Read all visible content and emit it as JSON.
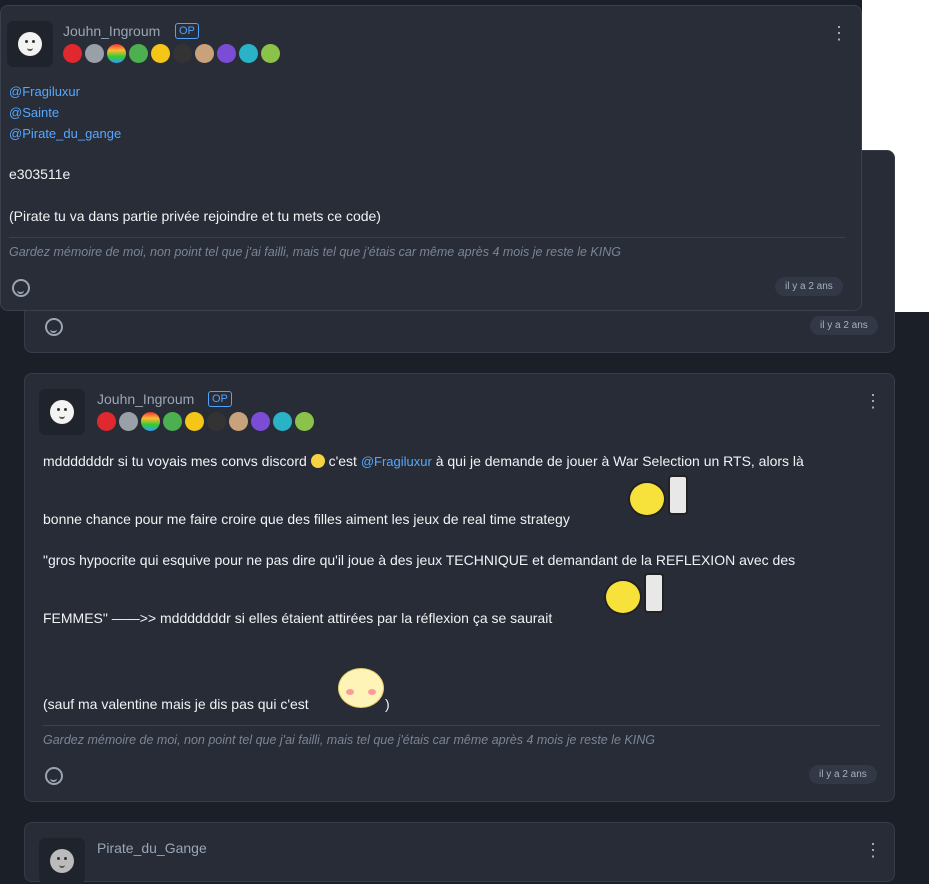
{
  "post1": {
    "username": "Jouhn_Ingroum",
    "op": "OP",
    "mentions": [
      "@Fragiluxur",
      "@Sainte",
      "@Pirate_du_gange"
    ],
    "code": "e303511e",
    "instruction": "(Pirate tu va dans partie privée rejoindre et tu mets ce code)",
    "signature": "Gardez mémoire de moi, non point tel que j'ai failli, mais tel que j'étais car même après 4 mois je reste le KING",
    "time": "il y a 2 ans"
  },
  "post0": {
    "time": "il y a 2 ans"
  },
  "post2": {
    "username": "Jouhn_Ingroum",
    "op": "OP",
    "line1_a": "mdddddddr si tu voyais mes convs discord",
    "line1_b": "c'est",
    "line1_mention": "@Fragiluxur",
    "line1_c": "à qui je demande de jouer à War Selection un RTS, alors là",
    "line2": "bonne chance pour me faire croire que des filles aiment les jeux de real time strategy",
    "line3": "\"gros hypocrite qui esquive pour ne pas dire qu'il joue à des jeux TECHNIQUE et demandant de la REFLEXION avec des",
    "line4": "FEMMES\" ——>> mdddddddr si elles étaient attirées par la réflexion ça se saurait",
    "line5_a": "(sauf ma valentine mais je dis pas qui c'est",
    "line5_b": ")",
    "signature": "Gardez mémoire de moi, non point tel que j'ai failli, mais tel que j'étais car même après 4 mois je reste le KING",
    "time": "il y a 2 ans"
  },
  "post3": {
    "username": "Pirate_du_Gange"
  },
  "badge_colors": [
    "#e0282e",
    "#9aa0a8",
    "#f3a82b",
    "#4caf50",
    "#f5c518",
    "#333333",
    "#c8a27a",
    "#7b4dd6",
    "#2ab3c7",
    "#8bc34a"
  ],
  "icons": {
    "menu": "kebab-menu-icon",
    "react": "add-reaction-icon",
    "avatar": "ghost-avatar"
  }
}
